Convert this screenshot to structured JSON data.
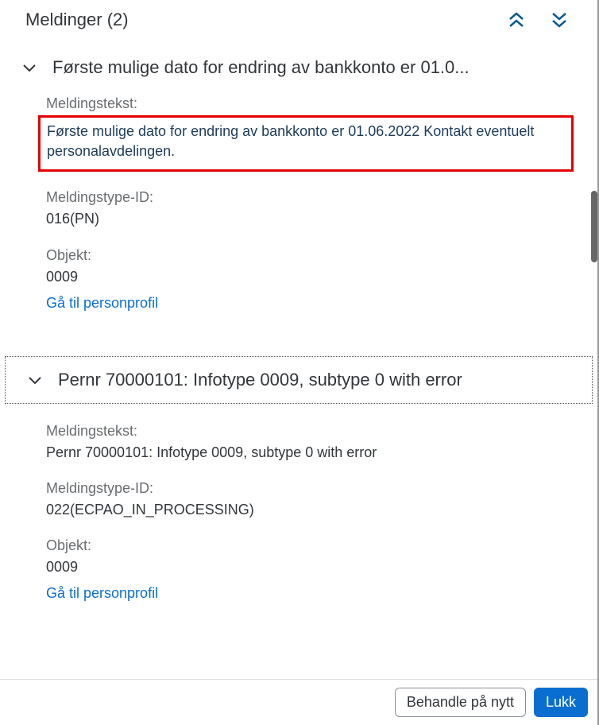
{
  "header": {
    "title": "Meldinger (2)"
  },
  "messages": [
    {
      "title": "Første mulige dato for endring av bankkonto er 01.0...",
      "fields": {
        "text_label": "Meldingstekst:",
        "text_value": "Første mulige dato for endring av bankkonto er 01.06.2022 Kontakt eventuelt personalavdelingen.",
        "type_label": "Meldingstype-ID:",
        "type_value": "016(PN)",
        "object_label": "Objekt:",
        "object_value": "0009"
      },
      "link": "Gå til personprofil"
    },
    {
      "title": "Pernr 70000101: Infotype 0009, subtype 0 with error",
      "fields": {
        "text_label": "Meldingstekst:",
        "text_value": "Pernr 70000101: Infotype 0009, subtype 0 with error",
        "type_label": "Meldingstype-ID:",
        "type_value": "022(ECPAO_IN_PROCESSING)",
        "object_label": "Objekt:",
        "object_value": "0009"
      },
      "link": "Gå til personprofil"
    }
  ],
  "footer": {
    "retry": "Behandle på nytt",
    "close": "Lukk"
  }
}
